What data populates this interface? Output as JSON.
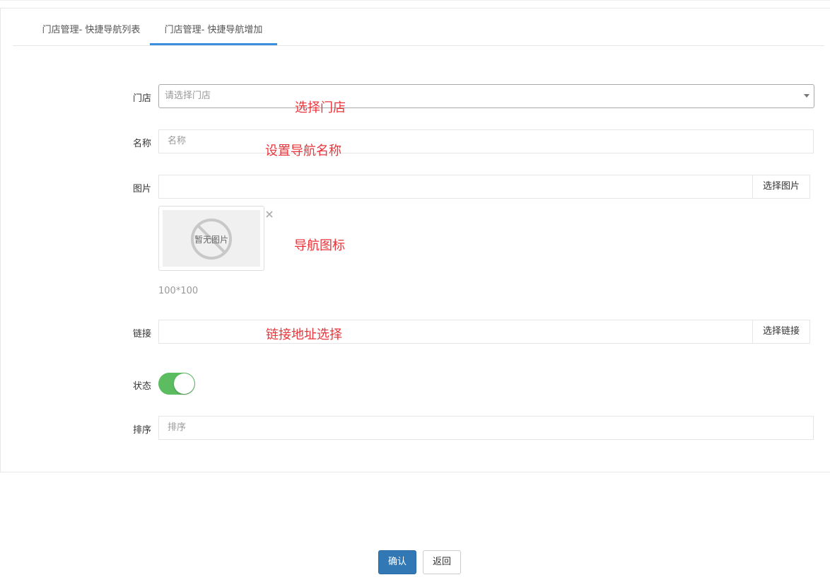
{
  "tabs": [
    {
      "label": "门店管理- 快捷导航列表"
    },
    {
      "label": "门店管理- 快捷导航增加"
    }
  ],
  "form": {
    "store": {
      "label": "门店",
      "placeholder": "请选择门店",
      "annotation": "选择门店"
    },
    "name": {
      "label": "名称",
      "placeholder": "名称",
      "annotation": "设置导航名称"
    },
    "image": {
      "label": "图片",
      "button": "选择图片",
      "preview_text": "暂无图片",
      "annotation": "导航图标",
      "size_hint": "100*100"
    },
    "link": {
      "label": "链接",
      "button": "选择链接",
      "annotation": "链接地址选择"
    },
    "status": {
      "label": "状态",
      "enabled": true
    },
    "sort": {
      "label": "排序",
      "placeholder": "排序"
    }
  },
  "actions": {
    "confirm": "确认",
    "back": "返回"
  },
  "colors": {
    "accent": "#3b8fe0",
    "toggle_on": "#5bbc60",
    "primary_button": "#3278b5",
    "annotation": "#e8353b"
  }
}
